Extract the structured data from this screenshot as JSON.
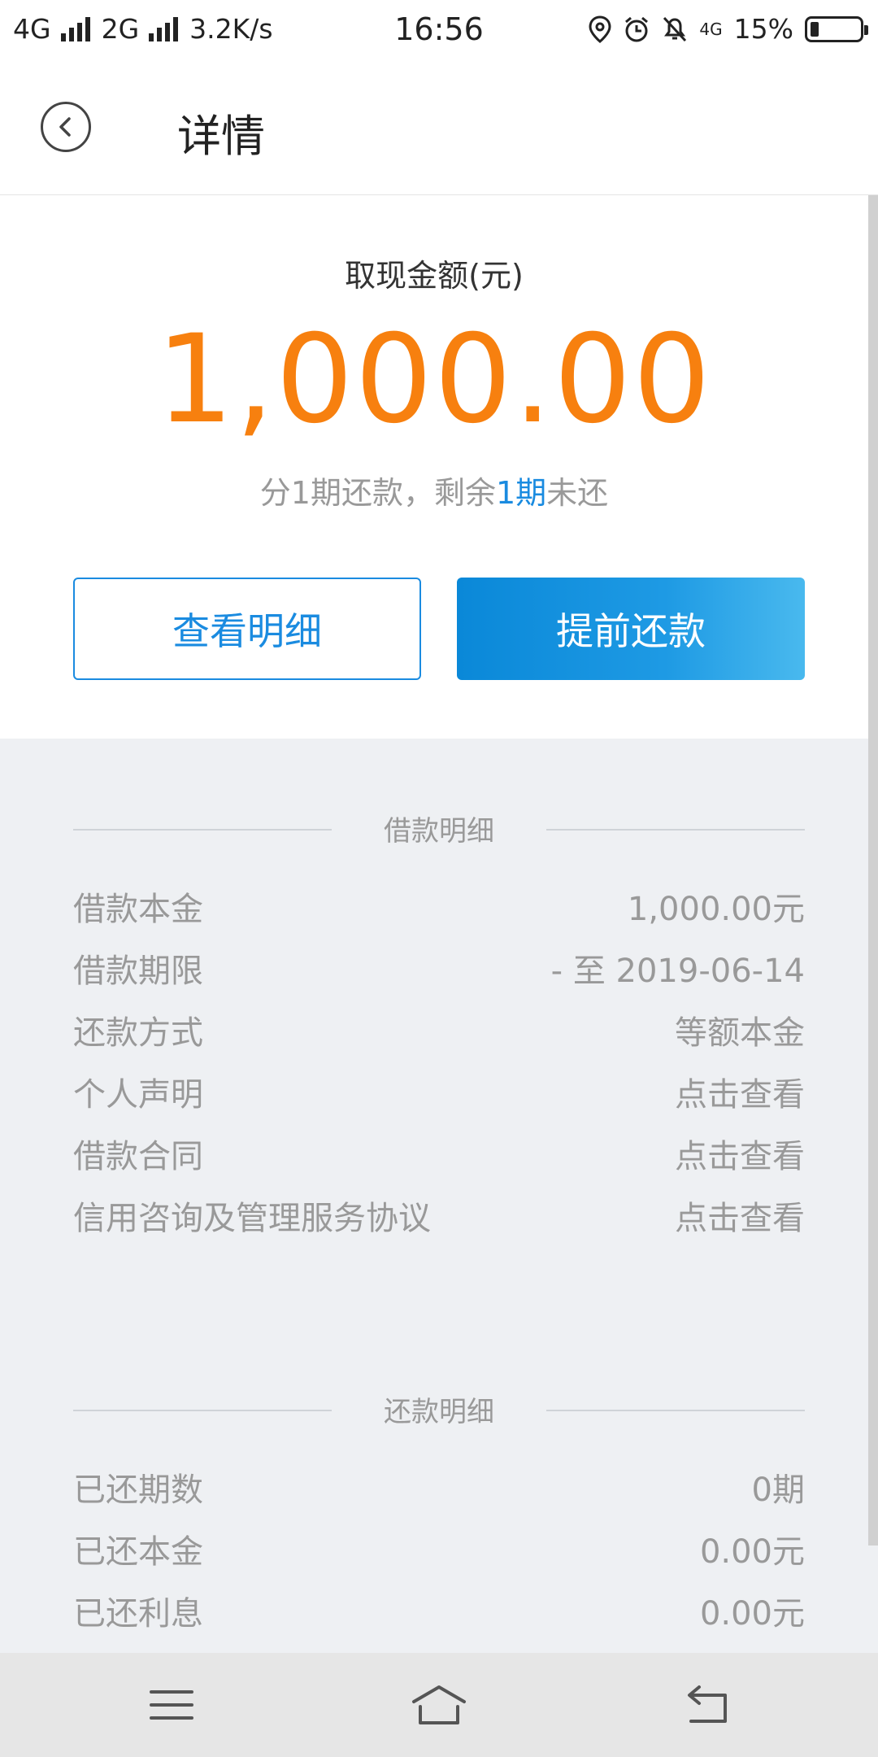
{
  "status_bar": {
    "network1": "4G",
    "network2": "2G",
    "speed": "3.2K/s",
    "time": "16:56",
    "mini_net": "4G",
    "battery": "15%"
  },
  "header": {
    "title": "详情"
  },
  "summary": {
    "amount_label": "取现金额(元)",
    "amount": "1,000.00",
    "installment_prefix": "分1期还款，剩余",
    "installment_highlight": "1期",
    "installment_suffix": "未还",
    "btn_detail": "查看明细",
    "btn_repay": "提前还款",
    "highlight_color": "#1a8be0",
    "amount_color": "#f7800f"
  },
  "loan_detail": {
    "title": "借款明细",
    "rows": [
      {
        "label": "借款本金",
        "value": "1,000.00元"
      },
      {
        "label": "借款期限",
        "value": "- 至 2019-06-14"
      },
      {
        "label": "还款方式",
        "value": "等额本金"
      },
      {
        "label": "个人声明",
        "value": "点击查看"
      },
      {
        "label": "借款合同",
        "value": "点击查看"
      },
      {
        "label": "信用咨询及管理服务协议",
        "value": "点击查看"
      }
    ]
  },
  "repay_detail": {
    "title": "还款明细",
    "rows": [
      {
        "label": "已还期数",
        "value": "0期"
      },
      {
        "label": "已还本金",
        "value": "0.00元"
      },
      {
        "label": "已还利息",
        "value": "0.00元"
      }
    ]
  },
  "nav": {
    "icons": [
      "menu-icon",
      "home-icon",
      "back-icon"
    ]
  }
}
